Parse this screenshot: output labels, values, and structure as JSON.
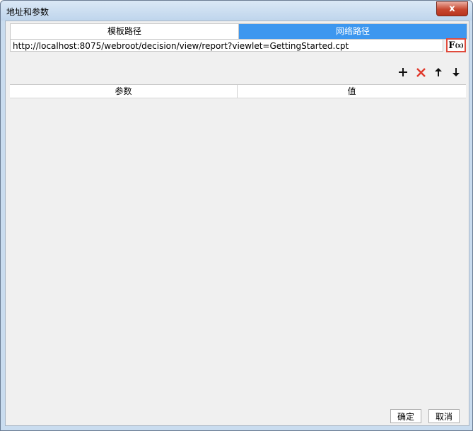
{
  "window": {
    "title": "地址和参数",
    "close_label": "x"
  },
  "tabs": [
    {
      "label": "模板路径",
      "active": false
    },
    {
      "label": "网络路径",
      "active": true
    }
  ],
  "url": {
    "value": "http://localhost:8075/webroot/decision/view/report?viewlet=GettingStarted.cpt"
  },
  "formula_button": {
    "main": "F",
    "sub": "(x)"
  },
  "toolbar": {
    "add_icon": "plus-icon",
    "delete_icon": "delete-icon",
    "up_icon": "arrow-up-icon",
    "down_icon": "arrow-down-icon"
  },
  "table": {
    "columns": [
      "参数",
      "值"
    ],
    "rows": []
  },
  "footer": {
    "ok_label": "确定",
    "cancel_label": "取消"
  },
  "colors": {
    "active_tab": "#3d97ef",
    "delete_icon": "#e0392b",
    "formula_border": "#e04b3c"
  }
}
